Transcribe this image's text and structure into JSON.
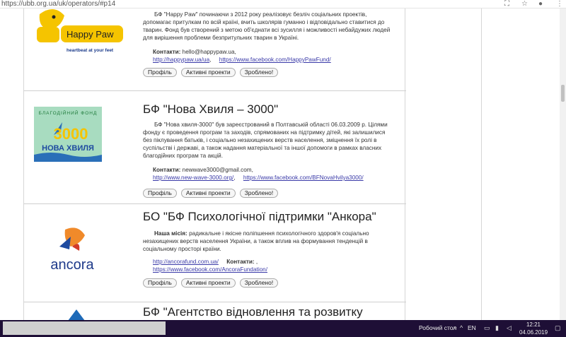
{
  "browser": {
    "url": "https://ubb.org.ua/uk/operators/#p14"
  },
  "orgs": [
    {
      "logo_text": "Happy Paw",
      "logo_tagline": "heartbeat at your feet",
      "desc": "БФ \"Happy Paw\" починаючи з 2012 року реалізовує безліч соціальних проектів, допомагає притулкам по всій країні, вчить школярів гуманно і відповідально ставитися до тварин. Фонд був створений з метою об'єднати всі зусилля і можливості небайдужих людей для вирішення проблеми безпритульних тварин в Україні.",
      "contacts_label": "Контакти:",
      "contacts_value": " hello@happypaw.ua,",
      "link1": "http://happypaw.ua/ua",
      "link1_sep": ",",
      "link2": "https://www.facebook.com/HappyPawFund/",
      "buttons": [
        "Профіль",
        "Активні проекти",
        "Зроблено!"
      ]
    },
    {
      "logo_arc": "БЛАГОДІЙНИЙ ФОНД",
      "logo_num": "3000",
      "logo_name": "НОВА ХВИЛЯ",
      "title": "БФ \"Нова Хвиля – 3000\"",
      "desc": "БФ \"Нова хвиля-3000\" був зареєстрований в Полтавській області 06.03.2009 р. Цілями фонду є проведення програм та заходів, спрямованих на підтримку дітей, які залишилися без піклування батьків, і соціально незахищених верств населення, зміцнення їх ролі в суспільстві і державі, а також надання матеріальної та іншої допомоги в рамках власних благодійних програм та акцій.",
      "contacts_label": "Контакти:",
      "contacts_value": " newwave3000@gmail.com,",
      "link1": "http://www.new-wave-3000.org/",
      "link1_sep": ",",
      "link2": "https://www.facebook.com/BFNovaHvilya3000/",
      "buttons": [
        "Профіль",
        "Активні проекти",
        "Зроблено!"
      ]
    },
    {
      "logo_text": "ancora",
      "title": "БО \"БФ Психологічної підтримки \"Анкора\"",
      "mission_label": "Наша місія:",
      "desc": " радикальне і якісне поліпшення психологічного здоров'я соціально незахищених верств населення України, а також вплив на формування тенденцій в соціальному просторі країни.",
      "link1": "http://ancorafund.com.ua/",
      "contacts_label": "Контакти:",
      "contacts_value": " ,",
      "link2": "https://www.facebook.com/AncoraFundation/",
      "buttons": [
        "Профіль",
        "Активні проекти",
        "Зроблено!"
      ]
    },
    {
      "title": "БФ \"Агентство відновлення та розвитку"
    }
  ],
  "taskbar": {
    "desktop_label": "Робочий стол",
    "lang": "EN",
    "time": "12:21",
    "date": "04.06.2019"
  }
}
